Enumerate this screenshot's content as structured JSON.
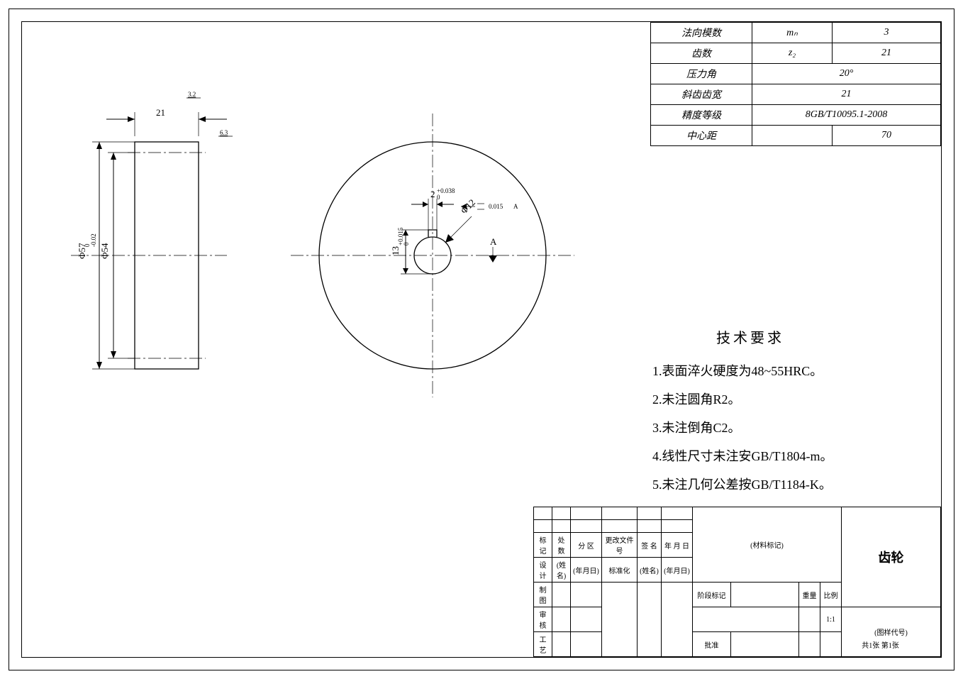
{
  "params": {
    "normal_module_label": "法向模数",
    "normal_module_sym": "mₙ",
    "normal_module_val": "3",
    "teeth_label": "齿数",
    "teeth_sym": "z₂",
    "teeth_val": "21",
    "pressure_label": "压力角",
    "pressure_val": "20°",
    "helix_label": "斜齿齿宽",
    "helix_val": "21",
    "grade_label": "精度等级",
    "grade_val": "8GB/T10095.1-2008",
    "center_label": "中心距",
    "center_val": "70"
  },
  "requirements": {
    "title": "技术要求",
    "items": [
      "1.表面淬火硬度为48~55HRC。",
      "2.未注圆角R2。",
      "3.未注倒角C2。",
      "4.线性尺寸未注安GB/T1804-m。",
      "5.未注几何公差按GB/T1184-K。"
    ]
  },
  "dims": {
    "width": "21",
    "ra_top": "3.2",
    "ra_side": "6.3",
    "d_outer": "Φ57",
    "d_outer_tol_top": "0",
    "d_outer_tol_bot": "-0.02",
    "d_pitch": "Φ54",
    "key_w": "2",
    "key_w_tol_top": "+0.038",
    "key_w_tol_bot": "0",
    "key_h": "13",
    "key_h_tol_top": "+0.015",
    "key_h_tol_bot": "0",
    "bore": "Φ12",
    "sym_tol": "0.015",
    "datum": "A"
  },
  "titleblock": {
    "hdr_mark": "标记",
    "hdr_qty": "处数",
    "hdr_div": "分 区",
    "hdr_doc": "更改文件号",
    "hdr_sig": "签 名",
    "hdr_date": "年 月 日",
    "design": "设计",
    "name_ph": "(姓名)",
    "date_ph": "(年月日)",
    "std": "标准化",
    "drawn": "制图",
    "check": "审核",
    "proc": "工艺",
    "appr": "批准",
    "stage": "阶段标记",
    "weight": "重量",
    "scale": "比例",
    "scale_val": "1:1",
    "sheets": "共1张 第1张",
    "material": "(材料标记)",
    "part_name": "齿轮",
    "drawing_no": "(图样代号)"
  }
}
